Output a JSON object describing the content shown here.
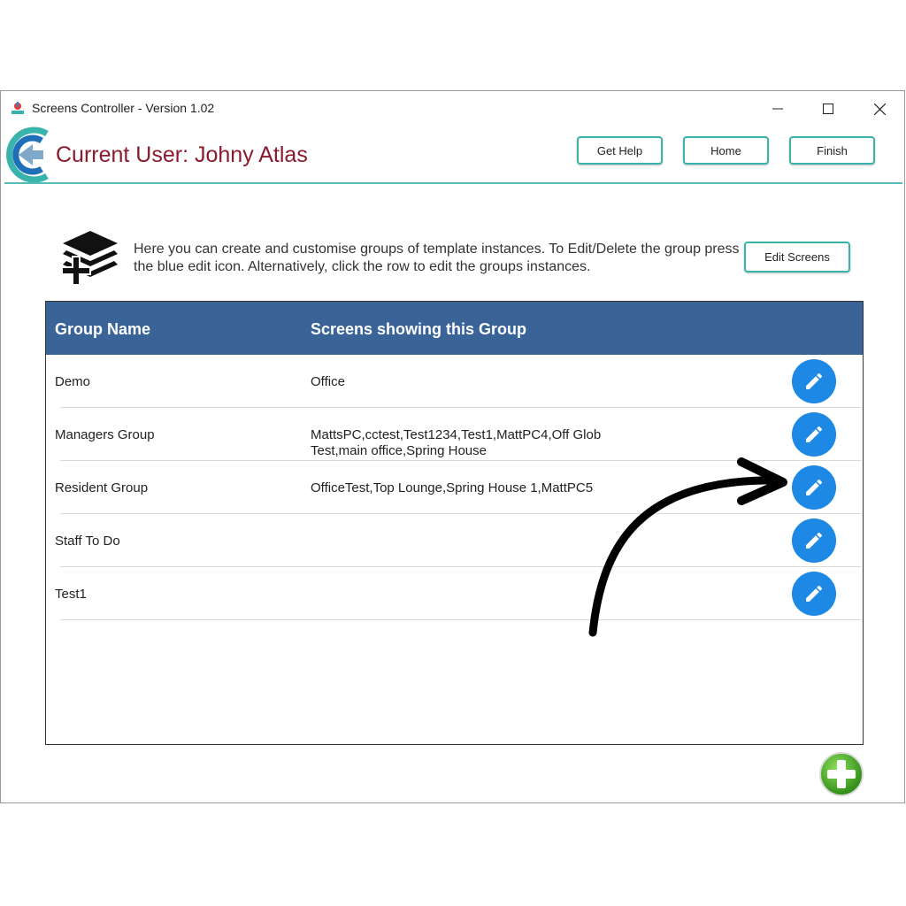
{
  "window": {
    "title": "Screens Controller - Version 1.02"
  },
  "header": {
    "current_user": "Current User: Johny Atlas",
    "buttons": {
      "help": "Get Help",
      "home": "Home",
      "finish": "Finish"
    }
  },
  "info": {
    "text": "Here you can create and customise groups of template instances. To Edit/Delete the group press the blue edit icon. Alternatively, click the row to edit the groups instances.",
    "edit_screens": "Edit Screens"
  },
  "table": {
    "columns": {
      "group_name": "Group Name",
      "screens": "Screens showing this Group"
    },
    "rows": [
      {
        "name": "Demo",
        "screens": "Office"
      },
      {
        "name": "Managers Group",
        "screens": "MattsPC,cctest,Test1234,Test1,MattPC4,Off Glob Test,main office,Spring House"
      },
      {
        "name": "Resident Group",
        "screens": "OfficeTest,Top Lounge,Spring House 1,MattPC5"
      },
      {
        "name": "Staff To Do",
        "screens": ""
      },
      {
        "name": "Test1",
        "screens": ""
      }
    ]
  },
  "icons": {
    "app": "screens-controller-icon",
    "logo": "screens-controller-logo",
    "info": "layers-add-icon",
    "edit": "pencil-icon",
    "add": "plus-icon",
    "annotation": "curved-arrow"
  },
  "colors": {
    "accent": "#3bb3ad",
    "user_text": "#8b1a2b",
    "table_header": "#3a6498",
    "edit_button": "#1e88e5",
    "add_button": "#4caf2a"
  }
}
